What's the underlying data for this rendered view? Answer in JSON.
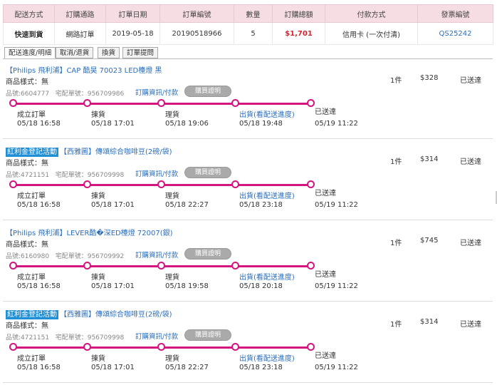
{
  "summary": {
    "headers": [
      "配送方式",
      "訂購通路",
      "訂單日期",
      "訂單編號",
      "數量",
      "訂購總額",
      "付款方式",
      "發票編號"
    ],
    "row": {
      "shipping": "快速到貨",
      "channel": "網路訂單",
      "date": "2019-05-18",
      "order_no": "20190518966",
      "quantity": "5",
      "total": "$1,701",
      "payment": "信用卡 (一次付清)",
      "invoice": "QS25242"
    }
  },
  "tabs": [
    "配送進度/明細",
    "取消/退貨",
    "換貨",
    "訂單提問"
  ],
  "colors": {
    "accent": "#d4147f",
    "link": "#2a6ebb",
    "price_red": "#d9232d",
    "badge_blue": "#1f8fd6"
  },
  "items": [
    {
      "badge": "",
      "title": "【Philips 飛利浦】CAP 酷昊 70023 LED檯燈 黑",
      "style": "商品樣式：無",
      "item_no": "品號:6604777",
      "delivery_no": "宅配單號：956709986",
      "info_link": "訂購資訊/付款",
      "buy_btn": "購買證明",
      "qty": "1件",
      "price": "$328",
      "status": "已送達",
      "steps": [
        {
          "label": "成立訂單",
          "time": "05/18 16:58"
        },
        {
          "label": "揀貨",
          "time": "05/18 17:01"
        },
        {
          "label": "理貨",
          "time": "05/18 19:06"
        },
        {
          "label": "出貨(看配送進度)",
          "time": "05/18 19:48"
        },
        {
          "label": "已送達",
          "time": "05/19 11:22"
        }
      ]
    },
    {
      "badge": "紅利金登記活動",
      "title": "【西雅圖】傳頌綜合咖啡豆(2磅/袋)",
      "style": "商品樣式：無",
      "item_no": "品號:4721151",
      "delivery_no": "宅配單號：956709998",
      "info_link": "訂購資訊/付款",
      "buy_btn": "購買證明",
      "qty": "1件",
      "price": "$314",
      "status": "已送達",
      "steps": [
        {
          "label": "成立訂單",
          "time": "05/18 16:58"
        },
        {
          "label": "揀貨",
          "time": "05/18 17:01"
        },
        {
          "label": "理貨",
          "time": "05/18 22:27"
        },
        {
          "label": "出貨(看配送進度)",
          "time": "05/18 23:18"
        },
        {
          "label": "已送達",
          "time": "05/19 11:22"
        }
      ]
    },
    {
      "badge": "",
      "title": "【Philips 飛利浦】LEVER酷�深ED檯燈 72007(銀)",
      "style": "商品樣式：無",
      "item_no": "品號:6160980",
      "delivery_no": "宅配單號：956709992",
      "info_link": "訂購資訊/付款",
      "buy_btn": "購買證明",
      "qty": "1件",
      "price": "$745",
      "status": "已送達",
      "steps": [
        {
          "label": "成立訂單",
          "time": "05/18 16:58"
        },
        {
          "label": "揀貨",
          "time": "05/18 17:01"
        },
        {
          "label": "理貨",
          "time": "05/18 19:58"
        },
        {
          "label": "出貨(看配送進度)",
          "time": "05/18 20:18"
        },
        {
          "label": "已送達",
          "time": "05/19 11:22"
        }
      ]
    },
    {
      "badge": "紅利金登記活動",
      "title": "【西雅圖】傳頌綜合咖啡豆(2磅/袋)",
      "style": "商品樣式：無",
      "item_no": "品號:4721151",
      "delivery_no": "宅配單號：956709998",
      "info_link": "訂購資訊/付款",
      "buy_btn": "購買證明",
      "qty": "1件",
      "price": "$314",
      "status": "已送達",
      "steps": [
        {
          "label": "成立訂單",
          "time": "05/18 16:58"
        },
        {
          "label": "揀貨",
          "time": "05/18 17:01"
        },
        {
          "label": "理貨",
          "time": "05/18 22:27"
        },
        {
          "label": "出貨(看配送進度)",
          "time": "05/18 23:18"
        },
        {
          "label": "已送達",
          "time": "05/19 11:22"
        }
      ]
    }
  ]
}
